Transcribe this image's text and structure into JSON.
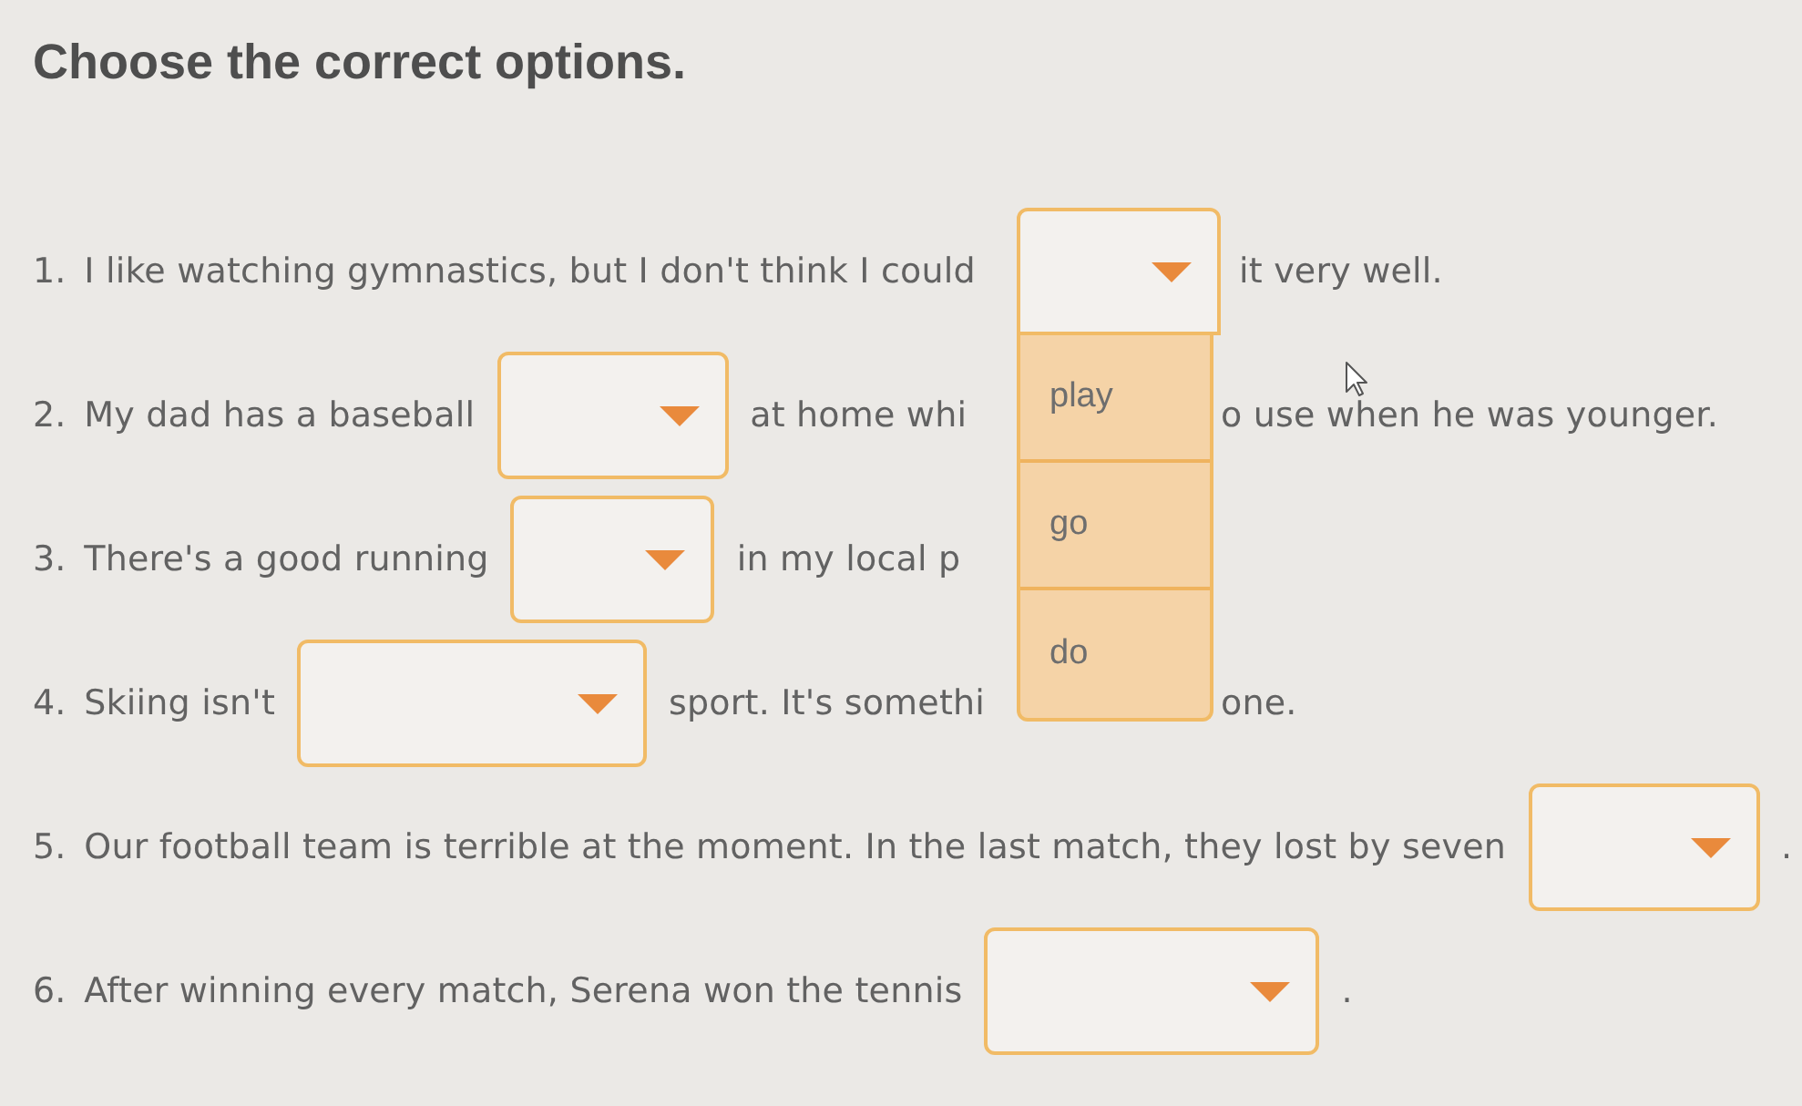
{
  "instruction": "Choose the correct options.",
  "questions": [
    {
      "number": "1.",
      "parts": [
        {
          "kind": "text",
          "text": "I like watching gymnastics, but I don't think I could"
        },
        {
          "kind": "dropdown",
          "expanded": true,
          "options": [
            {
              "text": "play",
              "selected": false
            },
            {
              "text": "go",
              "selected": false
            },
            {
              "text": "do",
              "selected": false
            }
          ]
        },
        {
          "kind": "text",
          "text": "it very well."
        }
      ]
    },
    {
      "number": "2.",
      "parts": [
        {
          "kind": "text",
          "text": "My dad has a baseball"
        },
        {
          "kind": "dropdown",
          "expanded": false
        },
        {
          "kind": "text",
          "text": "at home whi"
        },
        {
          "kind": "covered"
        },
        {
          "kind": "text",
          "text": "o use when he was younger."
        }
      ]
    },
    {
      "number": "3.",
      "parts": [
        {
          "kind": "text",
          "text": "There's a good running"
        },
        {
          "kind": "dropdown",
          "expanded": false
        },
        {
          "kind": "text",
          "text": "in my local p"
        },
        {
          "kind": "covered"
        }
      ]
    },
    {
      "number": "4.",
      "parts": [
        {
          "kind": "text",
          "text": "Skiing isn't"
        },
        {
          "kind": "dropdown",
          "expanded": false
        },
        {
          "kind": "text",
          "text": "sport. It's somethi"
        },
        {
          "kind": "covered"
        },
        {
          "kind": "text",
          "text": "one."
        }
      ]
    },
    {
      "number": "5.",
      "parts": [
        {
          "kind": "text",
          "text": "Our football team is terrible at the moment. In the last match, they lost by seven"
        },
        {
          "kind": "dropdown",
          "expanded": false
        },
        {
          "kind": "text",
          "text": "."
        }
      ]
    },
    {
      "number": "6.",
      "parts": [
        {
          "kind": "text",
          "text": "After winning every match, Serena won the tennis"
        },
        {
          "kind": "dropdown",
          "expanded": false
        },
        {
          "kind": "text",
          "text": "."
        }
      ]
    }
  ]
}
